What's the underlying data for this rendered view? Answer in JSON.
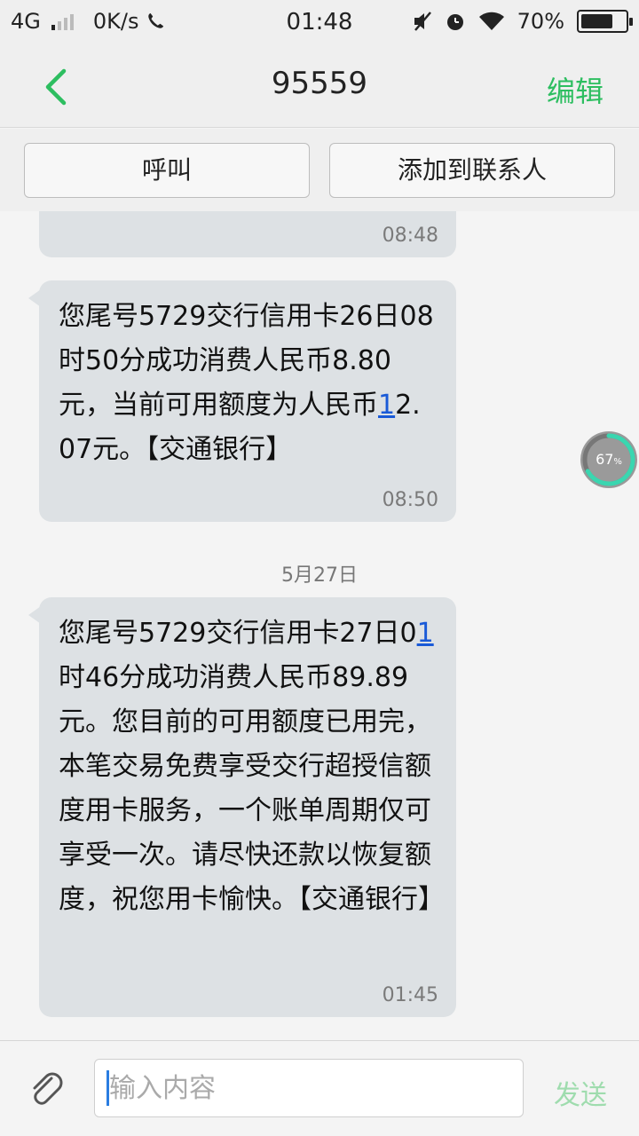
{
  "status_bar": {
    "network": "4G",
    "speed": "0K/s",
    "time": "01:48",
    "battery": "70%",
    "battery_level": 0.7
  },
  "header": {
    "title": "95559",
    "edit_label": "编辑"
  },
  "actions": {
    "call_label": "呼叫",
    "add_contact_label": "添加到联系人"
  },
  "messages": [
    {
      "text": "",
      "time": "08:48"
    },
    {
      "text_pre": "您尾号5729交行信用卡26日08时50分成功消费人民币8.80元，当前可用额度为人民币",
      "text_link": "1",
      "text_post": "2.07元。【交通银行】",
      "time": "08:50"
    },
    {
      "text_pre": "您尾号5729交行信用卡27日0",
      "text_link": "1",
      "text_post": "时46分成功消费人民币89.89元。您目前的可用额度已用完，本笔交易免费享受交行超授信额度用卡服务，一个账单周期仅可享受一次。请尽快还款以恢复额度，祝您用卡愉快。【交通银行】",
      "time": "01:45"
    }
  ],
  "date_separator": "5月27日",
  "progress_widget": {
    "value": 67,
    "label": "67",
    "unit": "%"
  },
  "input": {
    "placeholder": "输入内容",
    "send_label": "发送"
  },
  "colors": {
    "accent": "#2dbe60",
    "bubble": "#dde1e4",
    "link": "#1a5ad7"
  },
  "icons": [
    "back-chevron-icon",
    "mute-icon",
    "alarm-icon",
    "wifi-icon",
    "battery-icon",
    "attach-paperclip-icon",
    "call-icon"
  ]
}
